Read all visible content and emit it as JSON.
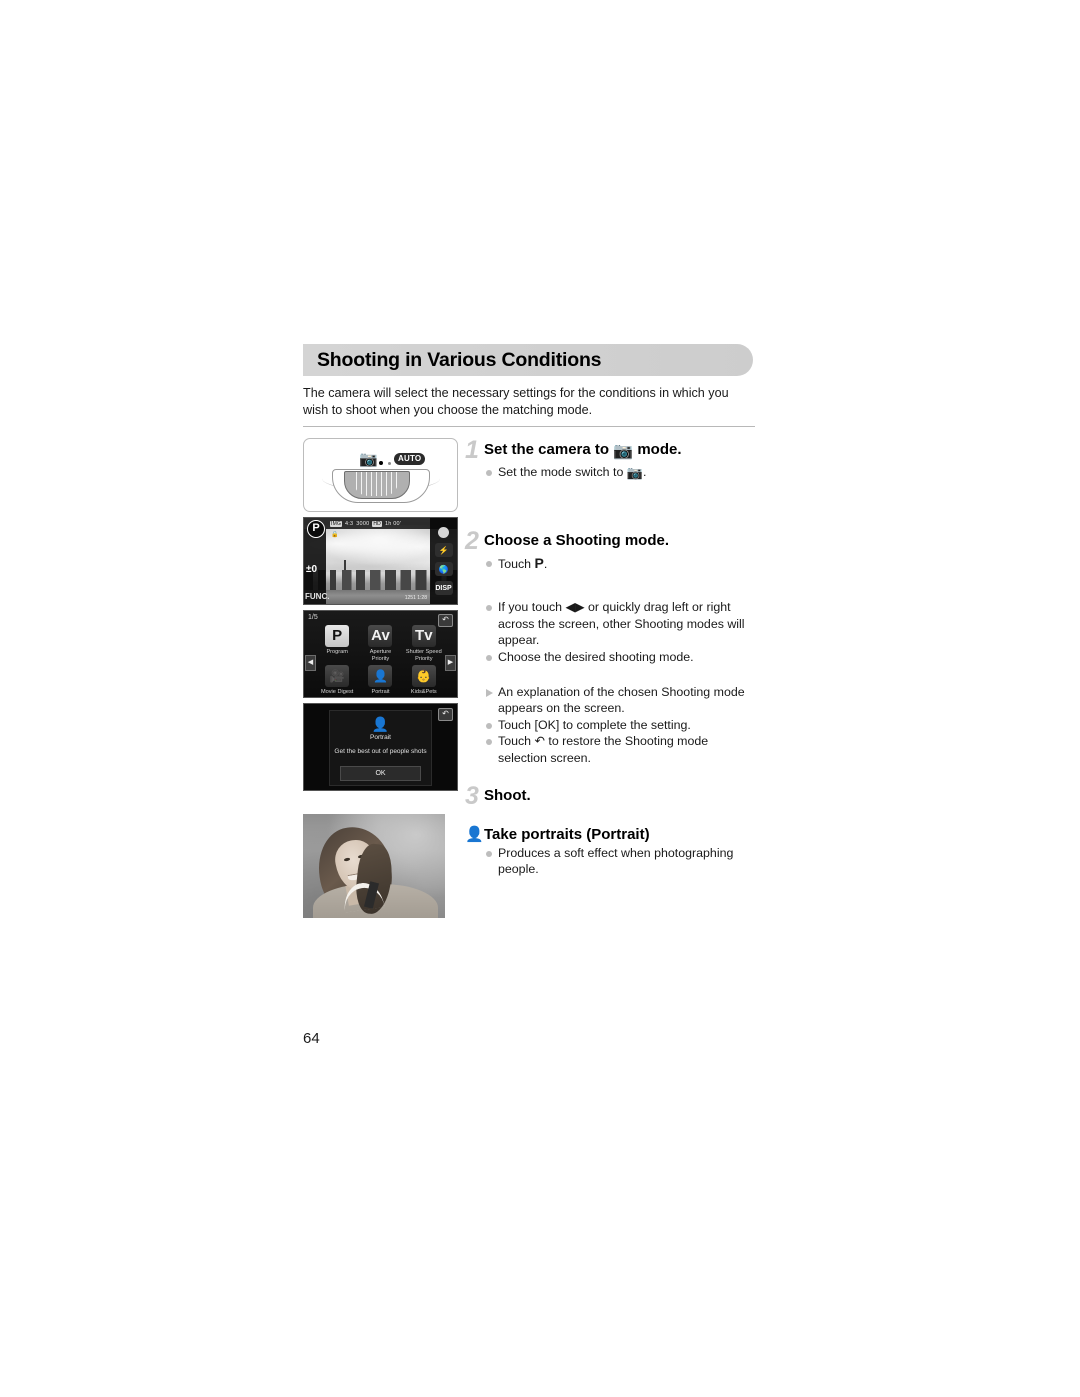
{
  "document": {
    "section_title": "Shooting in Various Conditions",
    "intro": "The camera will select the necessary settings for the conditions in which you wish to shoot when you choose the matching mode.",
    "page_number": "64"
  },
  "steps": [
    {
      "number": "1",
      "heading_before": "Set the camera to",
      "heading_icon": "camera-icon",
      "heading_after": "mode.",
      "bullets": [
        {
          "type": "dot",
          "before": "Set the mode switch to",
          "icon": "camera-icon",
          "after": "."
        }
      ]
    },
    {
      "number": "2",
      "heading": "Choose a Shooting mode.",
      "bullets": [
        {
          "type": "dot",
          "before": "Touch",
          "icon": "P",
          "after": "."
        },
        {
          "type": "dot",
          "text": "If you touch ◀▶ or quickly drag left or right across the screen, other Shooting modes will appear."
        },
        {
          "type": "dot",
          "text": "Choose the desired shooting mode."
        },
        {
          "type": "triangle",
          "text": "An explanation of the chosen Shooting mode appears on the screen."
        },
        {
          "type": "dot",
          "text": "Touch [OK] to complete the setting."
        },
        {
          "type": "dot",
          "before": "Touch",
          "icon": "↶",
          "after": "to restore the Shooting mode selection screen."
        }
      ]
    },
    {
      "number": "3",
      "heading": "Shoot.",
      "bullets": []
    }
  ],
  "subsection": {
    "icon": "portrait-mode-icon",
    "heading": "Take portraits (Portrait)",
    "bullets": [
      {
        "type": "dot",
        "text": "Produces a soft effect when photographing people."
      }
    ]
  },
  "figures": {
    "mode_switch": {
      "name": "mode-switch-illustration",
      "camera_icon": "camera-icon",
      "auto_label": "AUTO"
    },
    "shooting_screen": {
      "name": "shooting-screen",
      "mode_badge": "P",
      "top_status": [
        "IMG",
        "4:3",
        "3000",
        "HD",
        "1h 00'"
      ],
      "exposure_comp": "±0",
      "func_label": "FUNC.",
      "right_buttons": [
        "record-dot",
        "⚡A",
        "GPS",
        "DISP."
      ],
      "bottom_right": "1251 1:28"
    },
    "mode_grid": {
      "name": "shooting-mode-selection-screen",
      "page_indicator": "1/5",
      "back_icon": "↶",
      "prev_icon": "◀",
      "next_icon": "▶",
      "cells": [
        {
          "glyph": "P",
          "label": "Program",
          "selected": true,
          "icon": false
        },
        {
          "glyph": "Av",
          "label": "Aperture\nPriority",
          "selected": false,
          "icon": false
        },
        {
          "glyph": "Tv",
          "label": "Shutter Speed\nPriority",
          "selected": false,
          "icon": false
        },
        {
          "glyph": "🎥",
          "label": "Movie Digest",
          "selected": false,
          "icon": true
        },
        {
          "glyph": "👤",
          "label": "Portrait",
          "selected": false,
          "icon": true
        },
        {
          "glyph": "👶",
          "label": "Kids&Pets",
          "selected": false,
          "icon": true
        }
      ]
    },
    "explanation_screen": {
      "name": "mode-explanation-screen",
      "icon": "portrait-mode-icon",
      "title": "Portrait",
      "description": "Get the best out of people shots",
      "ok_label": "OK",
      "back_icon": "↶"
    },
    "portrait_photo": {
      "name": "portrait-sample-photo"
    }
  },
  "colors": {
    "banner_bg": "#d2d2d2",
    "step_number": "#c9c9c9",
    "bullet": "#bdbdbd",
    "rule": "#b8b8b8",
    "text": "#1a1a1a"
  }
}
